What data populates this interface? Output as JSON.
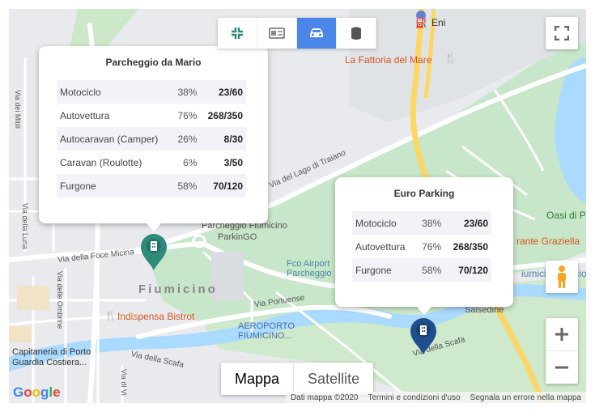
{
  "toolbar": {
    "buttons": [
      {
        "name": "collapse-icon",
        "active": false
      },
      {
        "name": "id-card-icon",
        "active": false
      },
      {
        "name": "car-icon",
        "active": true
      },
      {
        "name": "coins-icon",
        "active": false
      }
    ]
  },
  "popup_mario": {
    "title": "Parcheggio da Mario",
    "rows": [
      {
        "type": "Motociclo",
        "pct": "38%",
        "count": "23/60"
      },
      {
        "type": "Autovettura",
        "pct": "76%",
        "count": "268/350"
      },
      {
        "type": "Autocaravan (Camper)",
        "pct": "26%",
        "count": "8/30"
      },
      {
        "type": "Caravan (Roulotte)",
        "pct": "6%",
        "count": "3/50"
      },
      {
        "type": "Furgone",
        "pct": "58%",
        "count": "70/120"
      }
    ]
  },
  "popup_euro": {
    "title": "Euro Parking",
    "rows": [
      {
        "type": "Motociclo",
        "pct": "38%",
        "count": "23/60"
      },
      {
        "type": "Autovettura",
        "pct": "76%",
        "count": "268/350"
      },
      {
        "type": "Furgone",
        "pct": "58%",
        "count": "70/120"
      }
    ]
  },
  "map_labels": {
    "eni": "Eni",
    "fattoria": "La Fattoria del Mare",
    "lago_traiano": "Via del Lago di Traiano",
    "parcheggio_fiumicino": "Parcheggio Fiumicino",
    "parkingo": "ParkinGO",
    "foce_micina": "Via della Foce Micina",
    "fiumicino": "Fiumicino",
    "fco_airport": "Fco Airport",
    "parcheggio_s": "Parcheggio S",
    "via_portuense": "Via Portuense",
    "indispensa": "Indispensa Bistrot",
    "aeroporto": "AEROPORTO",
    "fiumicino_caps": "FIUMICINO...",
    "capitaneria": "Capitaneria di Porto",
    "guardia": "Guardia Costiera...",
    "via_scafa": "Via della Scafa",
    "salsedine": "Salsedine",
    "oasi": "Oasi di P",
    "grante": "rante Graziella",
    "fiumicino_calcio": "iumicino Calcio",
    "via_mitili": "Via dei Mitili",
    "via_ombrine": "Via delle Ombrine",
    "via_luna": "Via della Luna",
    "via_vi": "Via di Vi"
  },
  "map_type": {
    "map": "Mappa",
    "satellite": "Satellite"
  },
  "footer": {
    "google": "Google",
    "data": "Dati mappa ©2020",
    "terms": "Termini e condizioni d'uso",
    "report": "Segnala un errore nella mappa"
  },
  "colors": {
    "accent": "#4a86e8",
    "pin_green": "#2e8b7a",
    "pin_blue": "#1f4e8c",
    "park": "#c8e6c9",
    "water": "#aadaff",
    "road": "#ffffff",
    "major_road": "#fdd663"
  }
}
